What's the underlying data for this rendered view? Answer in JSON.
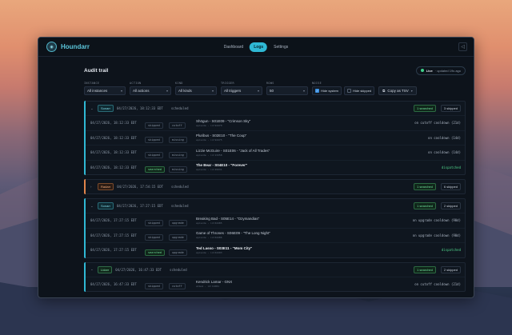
{
  "app": {
    "name": "Houndarr",
    "logo_glyph": "◉"
  },
  "nav": [
    "Dashboard",
    "Logs",
    "Settings"
  ],
  "active_nav": 1,
  "page": {
    "title": "Audit trail",
    "live_label": "Live",
    "live_updated": "· updated 19s ago"
  },
  "filters": {
    "instance": {
      "label": "INSTANCE",
      "value": "All instances"
    },
    "action": {
      "label": "ACTION",
      "value": "All actions"
    },
    "kind": {
      "label": "KIND",
      "value": "All kinds"
    },
    "trigger": {
      "label": "TRIGGER",
      "value": "All triggers"
    },
    "rows": {
      "label": "ROWS",
      "value": "50"
    },
    "noise": {
      "label": "NOISE",
      "hide_system": "Hide system",
      "hide_skipped": "Hide skipped"
    },
    "copy": "Copy as TSV"
  },
  "groups": [
    {
      "instance": "Sonarr",
      "color": "teal",
      "ts": "04/27/2026, 18:12:33 EDT",
      "kind": "scheduled",
      "searched": "1 searched",
      "skipped": "3 skipped",
      "rows": [
        {
          "ts": "04/27/2026, 18:12:33 EDT",
          "status": "skipped",
          "kind": "cutoff",
          "title": "Shōgun - S01E09 - \"Crimson Sky\"",
          "sub": "episode · id:94470",
          "result": "on cutoff cooldown (21d)",
          "strong": false
        },
        {
          "ts": "04/27/2026, 18:12:33 EDT",
          "status": "skipped",
          "kind": "missing",
          "title": "Pluribus - S02E10 - \"The Coup\"",
          "sub": "episode · id:94475",
          "result": "on cooldown (14d)",
          "strong": false
        },
        {
          "ts": "04/27/2026, 18:12:33 EDT",
          "status": "skipped",
          "kind": "missing",
          "title": "Lizzie McGuire - S01E06 - \"Jack of All Trades\"",
          "sub": "episode · id:13258",
          "result": "on cooldown (14d)",
          "strong": false
        },
        {
          "ts": "04/27/2026, 18:12:33 EDT",
          "status": "searched",
          "kind": "missing",
          "title": "The Bear - S04E10 - \"Forever\"",
          "sub": "episode · id:29931",
          "result": "dispatched",
          "strong": true
        }
      ]
    },
    {
      "instance": "Radarr",
      "color": "orange",
      "ts": "04/27/2026, 17:54:15 EDT",
      "kind": "scheduled",
      "searched": "1 searched",
      "skipped": "6 skipped",
      "rows": []
    },
    {
      "instance": "Sonarr",
      "color": "teal",
      "ts": "04/27/2026, 17:27:15 EDT",
      "kind": "scheduled",
      "searched": "1 searched",
      "skipped": "2 skipped",
      "rows": [
        {
          "ts": "04/27/2026, 17:27:15 EDT",
          "status": "skipped",
          "kind": "upgrade",
          "title": "Breaking Bad - S05E14 - \"Ozymandias\"",
          "sub": "episode · id:64485",
          "result": "on upgrade cooldown (90d)",
          "strong": false
        },
        {
          "ts": "04/27/2026, 17:27:15 EDT",
          "status": "skipped",
          "kind": "upgrade",
          "title": "Game of Thrones - S06E09 - \"The Long Night\"",
          "sub": "episode · id:64486",
          "result": "on upgrade cooldown (90d)",
          "strong": false
        },
        {
          "ts": "04/27/2026, 17:27:15 EDT",
          "status": "searched",
          "kind": "upgrade",
          "title": "Ted Lasso - S03E11 - \"Mom City\"",
          "sub": "episode · id:64493",
          "result": "dispatched",
          "strong": true
        }
      ]
    },
    {
      "instance": "Lidarr",
      "color": "green",
      "ts": "04/27/2026, 16:47:33 EDT",
      "kind": "scheduled",
      "searched": "1 searched",
      "skipped": "2 skipped",
      "rows": [
        {
          "ts": "04/27/2026, 16:47:33 EDT",
          "status": "skipped",
          "kind": "cutoff",
          "title": "Kendrick Lamar - GNX",
          "sub": "album · id:11081",
          "result": "on cutoff cooldown (21d)",
          "strong": false
        }
      ]
    }
  ]
}
